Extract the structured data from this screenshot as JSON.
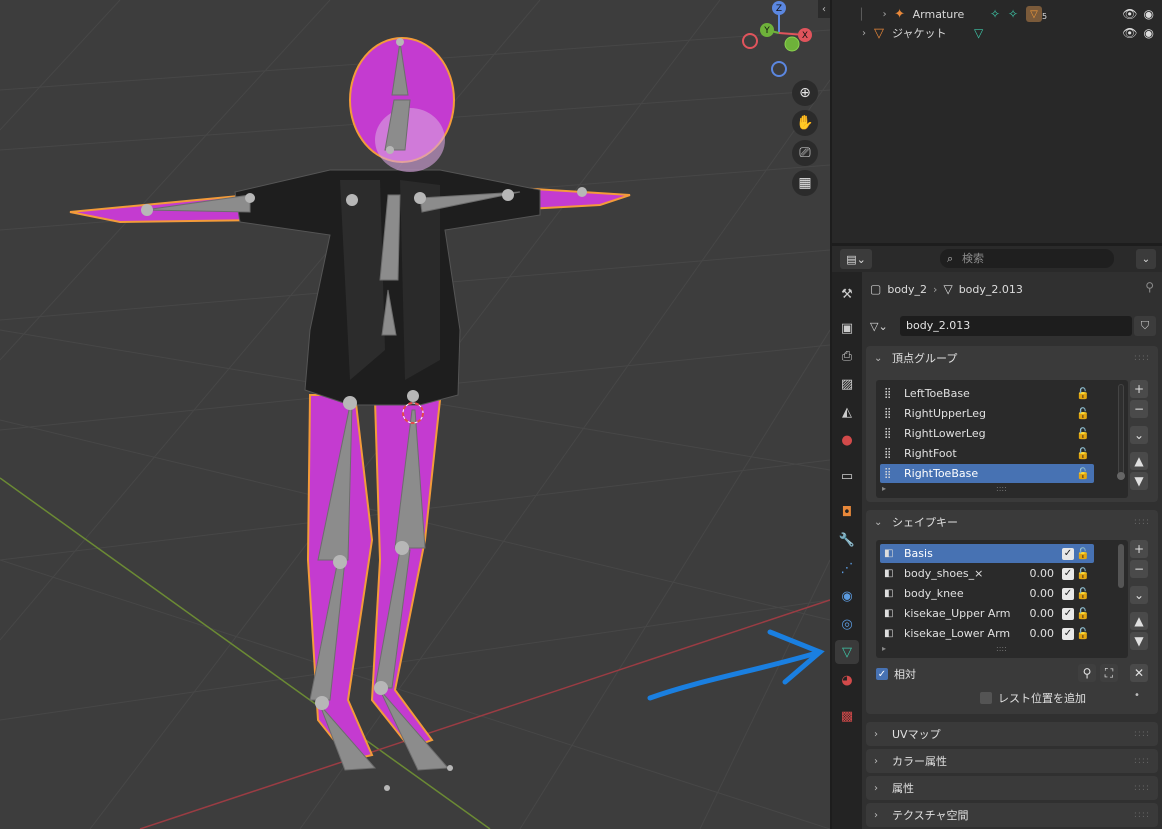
{
  "outliner": {
    "rows": [
      {
        "name": "Armature",
        "icon": "armature-icon",
        "extra_count": "5"
      },
      {
        "name": "ジャケット",
        "icon": "mesh-icon"
      }
    ]
  },
  "properties": {
    "search_placeholder": "検索",
    "breadcrumb": {
      "object": "body_2",
      "mesh": "body_2.013"
    },
    "mesh_name": "body_2.013",
    "vertex_groups": {
      "title": "頂点グループ",
      "items": [
        {
          "name": "LeftToeBase",
          "selected": false
        },
        {
          "name": "RightUpperLeg",
          "selected": false
        },
        {
          "name": "RightLowerLeg",
          "selected": false
        },
        {
          "name": "RightFoot",
          "selected": false
        },
        {
          "name": "RightToeBase",
          "selected": true
        }
      ]
    },
    "shape_keys": {
      "title": "シェイプキー",
      "items": [
        {
          "name": "Basis",
          "value": "",
          "selected": true
        },
        {
          "name": "body_shoes_×",
          "value": "0.00",
          "selected": false
        },
        {
          "name": "body_knee",
          "value": "0.00",
          "selected": false
        },
        {
          "name": "kisekae_Upper Arm",
          "value": "0.00",
          "selected": false
        },
        {
          "name": "kisekae_Lower Arm",
          "value": "0.00",
          "selected": false
        }
      ],
      "relative_label": "相対",
      "add_rest_label": "レスト位置を追加"
    },
    "collapsed_panels": [
      "UVマップ",
      "カラー属性",
      "属性",
      "テクスチャ空間"
    ]
  },
  "gizmo": {
    "z": "Z",
    "y": "Y",
    "x": "X"
  },
  "colors": {
    "selection_blue": "#4772b3",
    "outline_orange": "#f39b3a",
    "mesh_magenta": "#c43bd0",
    "annotation_blue": "#1a7fe0"
  }
}
